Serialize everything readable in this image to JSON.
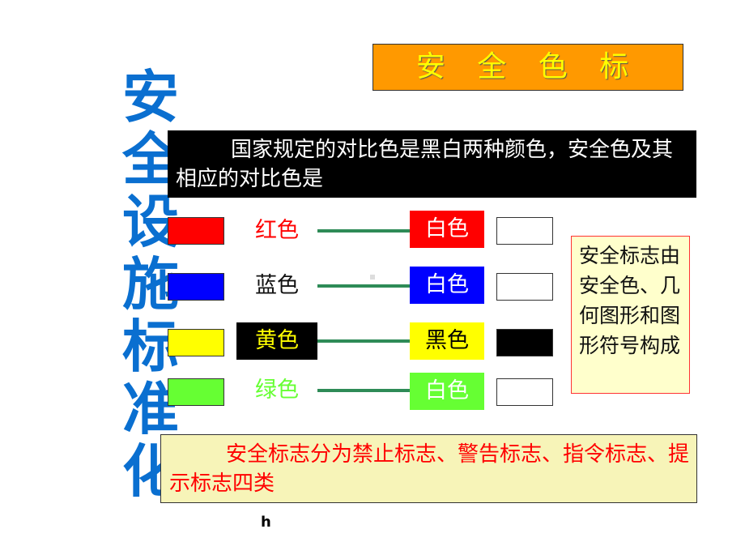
{
  "header": {
    "title": "安 全 色 标",
    "vertical_title": [
      "安",
      "全",
      "设",
      "施",
      "标",
      "准",
      "化"
    ]
  },
  "intro": "国家规定的对比色是黑白两种颜色，安全色及其相应的对比色是",
  "rows": [
    {
      "label": "红色",
      "color": "#ff0000",
      "label_color": "#ff0000",
      "label_bg": "transparent",
      "contrast_label": "白色",
      "contrast_bg": "#ff0000",
      "contrast_text": "#ffffff",
      "contrast_color": "#ffffff"
    },
    {
      "label": "蓝色",
      "color": "#0000ff",
      "label_color": "#111111",
      "label_bg": "transparent",
      "contrast_label": "白色",
      "contrast_bg": "#0000ff",
      "contrast_text": "#ffffff",
      "contrast_color": "#ffffff"
    },
    {
      "label": "黄色",
      "color": "#ffff00",
      "label_color": "#ffff00",
      "label_bg": "#000000",
      "contrast_label": "黑色",
      "contrast_bg": "#ffff00",
      "contrast_text": "#000000",
      "contrast_color": "#000000"
    },
    {
      "label": "绿色",
      "color": "#66ff33",
      "label_color": "#66ff33",
      "label_bg": "transparent",
      "contrast_label": "白色",
      "contrast_bg": "#66ff33",
      "contrast_text": "#ffffff",
      "contrast_color": "#ffffff"
    }
  ],
  "note": "安全标志由安全色、几何图形和图形符号构成",
  "bottom": "安全标志分为禁止标志、警告标志、指令标志、提示标志四类",
  "footer": "h"
}
